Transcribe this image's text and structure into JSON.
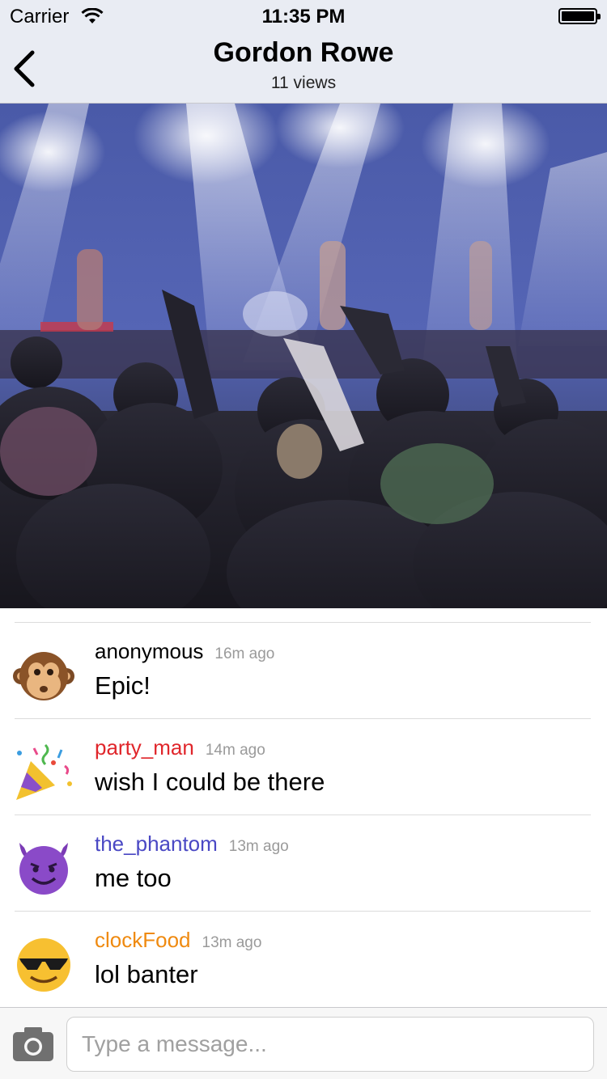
{
  "status_bar": {
    "carrier": "Carrier",
    "time": "11:35 PM"
  },
  "header": {
    "title": "Gordon Rowe",
    "subtitle": "11 views"
  },
  "comments": [
    {
      "username": "anonymous",
      "time_ago": "16m ago",
      "message": "Epic!",
      "avatar": "monkey-face-icon",
      "name_color": "#000000"
    },
    {
      "username": "party_man",
      "time_ago": "14m ago",
      "message": "wish I could be there",
      "avatar": "party-popper-icon",
      "name_color": "#e0262b"
    },
    {
      "username": "the_phantom",
      "time_ago": "13m ago",
      "message": "me too",
      "avatar": "smiling-devil-icon",
      "name_color": "#4a48c4"
    },
    {
      "username": "clockFood",
      "time_ago": "13m ago",
      "message": "lol banter",
      "avatar": "sunglasses-face-icon",
      "name_color": "#ef8a10"
    }
  ],
  "composer": {
    "placeholder": "Type a message..."
  }
}
